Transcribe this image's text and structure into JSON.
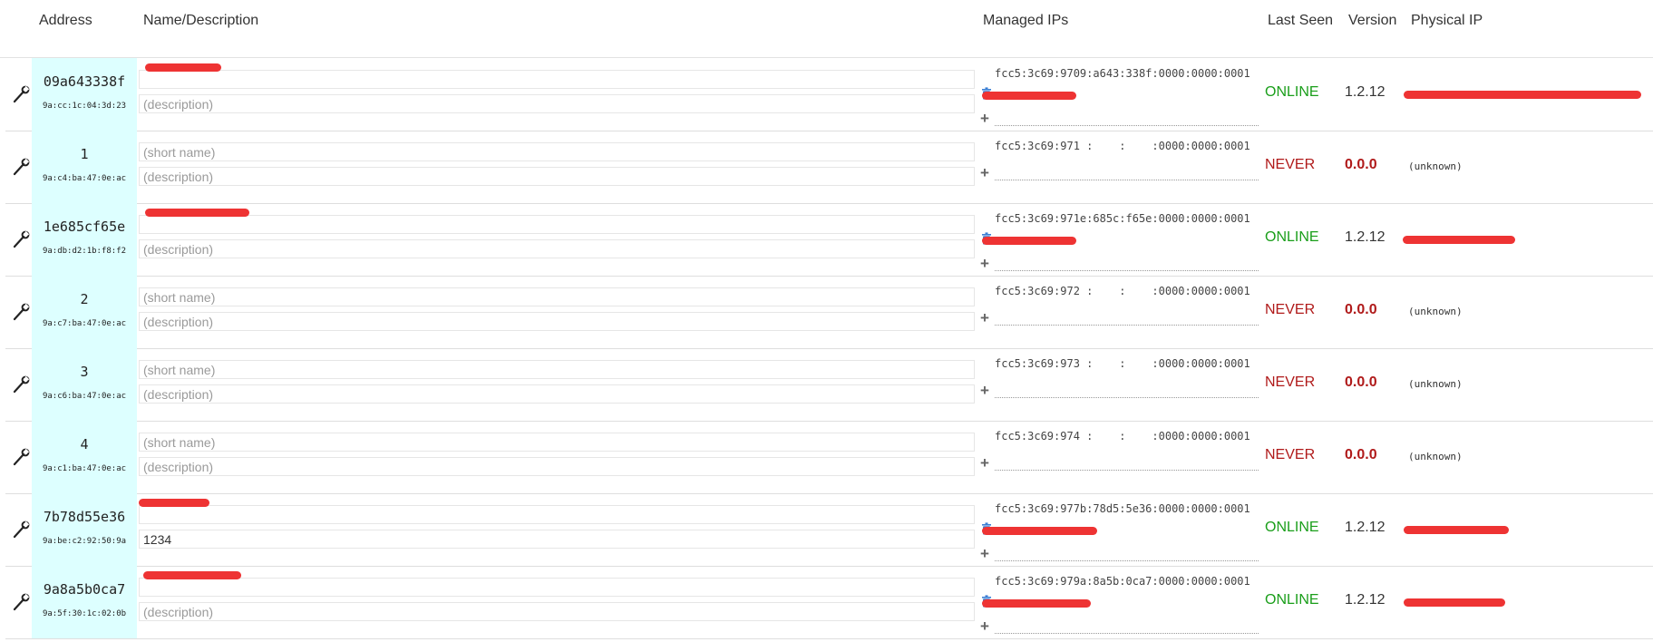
{
  "headers": {
    "address": "Address",
    "name_desc": "Name/Description",
    "managed_ips": "Managed IPs",
    "last_seen": "Last Seen",
    "version": "Version",
    "physical_ip": "Physical IP"
  },
  "placeholders": {
    "short_name": "(short name)",
    "description": "(description)"
  },
  "colors": {
    "online": "#1a9e1a",
    "never": "#b01a1a",
    "address_bg": "#ddffff",
    "redaction": "#ee3333"
  },
  "rows": [
    {
      "node_id": "09a643338f",
      "mac": "9a:cc:1c:04:3d:23",
      "short_name": "",
      "description": "",
      "ip": "fcc5:3c69:9709:a643:338f:0000:0000:0001",
      "status": "ONLINE",
      "version": "1.2.12",
      "physical_ip": ""
    },
    {
      "node_id": "1",
      "mac": "9a:c4:ba:47:0e:ac",
      "short_name": "",
      "description": "",
      "ip": "fcc5:3c69:971 :    :    :0000:0000:0001",
      "status": "NEVER",
      "version": "0.0.0",
      "physical_ip": "(unknown)"
    },
    {
      "node_id": "1e685cf65e",
      "mac": "9a:db:d2:1b:f8:f2",
      "short_name": "",
      "description": "",
      "ip": "fcc5:3c69:971e:685c:f65e:0000:0000:0001",
      "status": "ONLINE",
      "version": "1.2.12",
      "physical_ip": ""
    },
    {
      "node_id": "2",
      "mac": "9a:c7:ba:47:0e:ac",
      "short_name": "",
      "description": "",
      "ip": "fcc5:3c69:972 :    :    :0000:0000:0001",
      "status": "NEVER",
      "version": "0.0.0",
      "physical_ip": "(unknown)"
    },
    {
      "node_id": "3",
      "mac": "9a:c6:ba:47:0e:ac",
      "short_name": "",
      "description": "",
      "ip": "fcc5:3c69:973 :    :    :0000:0000:0001",
      "status": "NEVER",
      "version": "0.0.0",
      "physical_ip": "(unknown)"
    },
    {
      "node_id": "4",
      "mac": "9a:c1:ba:47:0e:ac",
      "short_name": "",
      "description": "",
      "ip": "fcc5:3c69:974 :    :    :0000:0000:0001",
      "status": "NEVER",
      "version": "0.0.0",
      "physical_ip": "(unknown)"
    },
    {
      "node_id": "7b78d55e36",
      "mac": "9a:be:c2:92:50:9a",
      "short_name": "",
      "description": "1234",
      "ip": "fcc5:3c69:977b:78d5:5e36:0000:0000:0001",
      "status": "ONLINE",
      "version": "1.2.12",
      "physical_ip": ""
    },
    {
      "node_id": "9a8a5b0ca7",
      "mac": "9a:5f:30:1c:02:0b",
      "short_name": "",
      "description": "",
      "ip": "fcc5:3c69:979a:8a5b:0ca7:0000:0000:0001",
      "status": "ONLINE",
      "version": "1.2.12",
      "physical_ip": ""
    }
  ]
}
